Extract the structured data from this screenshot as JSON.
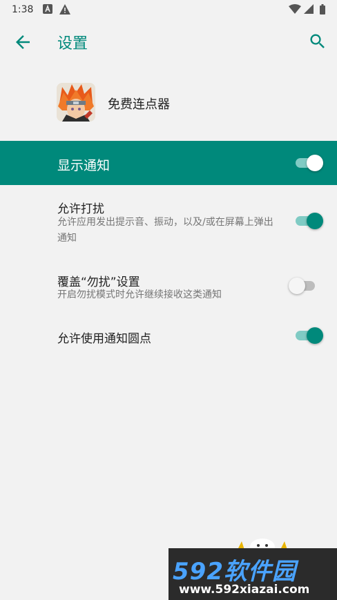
{
  "status_bar": {
    "time": "1:38",
    "icons": [
      "a-notification-icon",
      "warning-icon",
      "wifi-icon",
      "signal-icon",
      "battery-icon"
    ]
  },
  "app_bar": {
    "title": "设置",
    "back_icon": "arrow-back-icon",
    "search_icon": "search-icon"
  },
  "app_info": {
    "name": "免费连点器"
  },
  "master_toggle": {
    "label": "显示通知",
    "checked": true
  },
  "settings": [
    {
      "title": "允许打扰",
      "subtitle": "允许应用发出提示音、振动，以及/或在屏幕上弹出通知",
      "checked": true
    },
    {
      "title": "覆盖“勿扰”设置",
      "subtitle": "开启勿扰模式时允许继续接收这类通知",
      "checked": false
    },
    {
      "title": "允许使用通知圆点",
      "subtitle": "",
      "checked": true
    }
  ],
  "watermark": {
    "brand": "592软件园",
    "url": "www.592xiazai.com"
  },
  "colors": {
    "accent": "#00897b",
    "track_on": "#80cbc4",
    "background": "#f2f2f2",
    "watermark_blue": "#4aa3ff"
  }
}
